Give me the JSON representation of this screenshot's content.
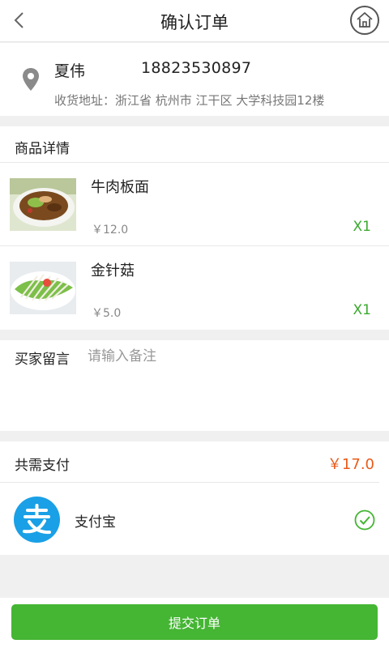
{
  "header": {
    "title": "确认订单",
    "back_icon": "chevron-left-icon",
    "home_icon": "home-icon"
  },
  "address": {
    "name": "夏伟",
    "phone": "18823530897",
    "line": "收货地址：浙江省 杭州市 江干区 大学科技园12楼",
    "icon": "location-pin-icon"
  },
  "goods": {
    "title": "商品详情",
    "items": [
      {
        "name": "牛肉板面",
        "price": "￥12.0",
        "qty": "X1"
      },
      {
        "name": "金针菇",
        "price": "￥5.0",
        "qty": "X1"
      }
    ]
  },
  "note": {
    "label": "买家留言",
    "placeholder": "请输入备注"
  },
  "payment": {
    "total_label": "共需支付",
    "total_value": "￥17.0",
    "method_label": "支付宝",
    "method_icon": "alipay-icon",
    "selected_icon": "check-circle-icon",
    "accent": "#e85b1a"
  },
  "submit": {
    "label": "提交订单",
    "color": "#45b534"
  }
}
